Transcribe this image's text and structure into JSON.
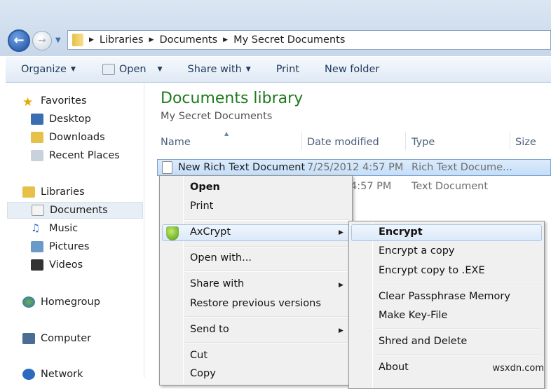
{
  "address": {
    "breadcrumb": [
      "Libraries",
      "Documents",
      "My Secret Documents"
    ]
  },
  "toolbar": {
    "organize": "Organize",
    "open": "Open",
    "share_with": "Share with",
    "print": "Print",
    "new_folder": "New folder"
  },
  "sidebar": {
    "favorites": "Favorites",
    "desktop": "Desktop",
    "downloads": "Downloads",
    "recent": "Recent Places",
    "libraries": "Libraries",
    "documents": "Documents",
    "music": "Music",
    "pictures": "Pictures",
    "videos": "Videos",
    "homegroup": "Homegroup",
    "computer": "Computer",
    "network": "Network"
  },
  "main": {
    "title": "Documents library",
    "subtitle": "My Secret Documents",
    "columns": [
      "Name",
      "Date modified",
      "Type",
      "Size"
    ],
    "files": [
      {
        "name": "New Rich Text Document",
        "date": "7/25/2012 4:57 PM",
        "type": "Rich Text Docume..."
      },
      {
        "date": "4:57 PM",
        "type": "Text Document"
      }
    ]
  },
  "context_menu": {
    "open": "Open",
    "print": "Print",
    "axcrypt": "AxCrypt",
    "open_with": "Open with...",
    "share_with": "Share with",
    "restore": "Restore previous versions",
    "send_to": "Send to",
    "cut": "Cut",
    "copy": "Copy"
  },
  "axcrypt_menu": {
    "encrypt": "Encrypt",
    "encrypt_copy": "Encrypt a copy",
    "encrypt_exe": "Encrypt copy to .EXE",
    "clear": "Clear Passphrase Memory",
    "keyfile": "Make Key-File",
    "shred": "Shred and Delete",
    "about": "About"
  },
  "watermark": "wsxdn.com"
}
